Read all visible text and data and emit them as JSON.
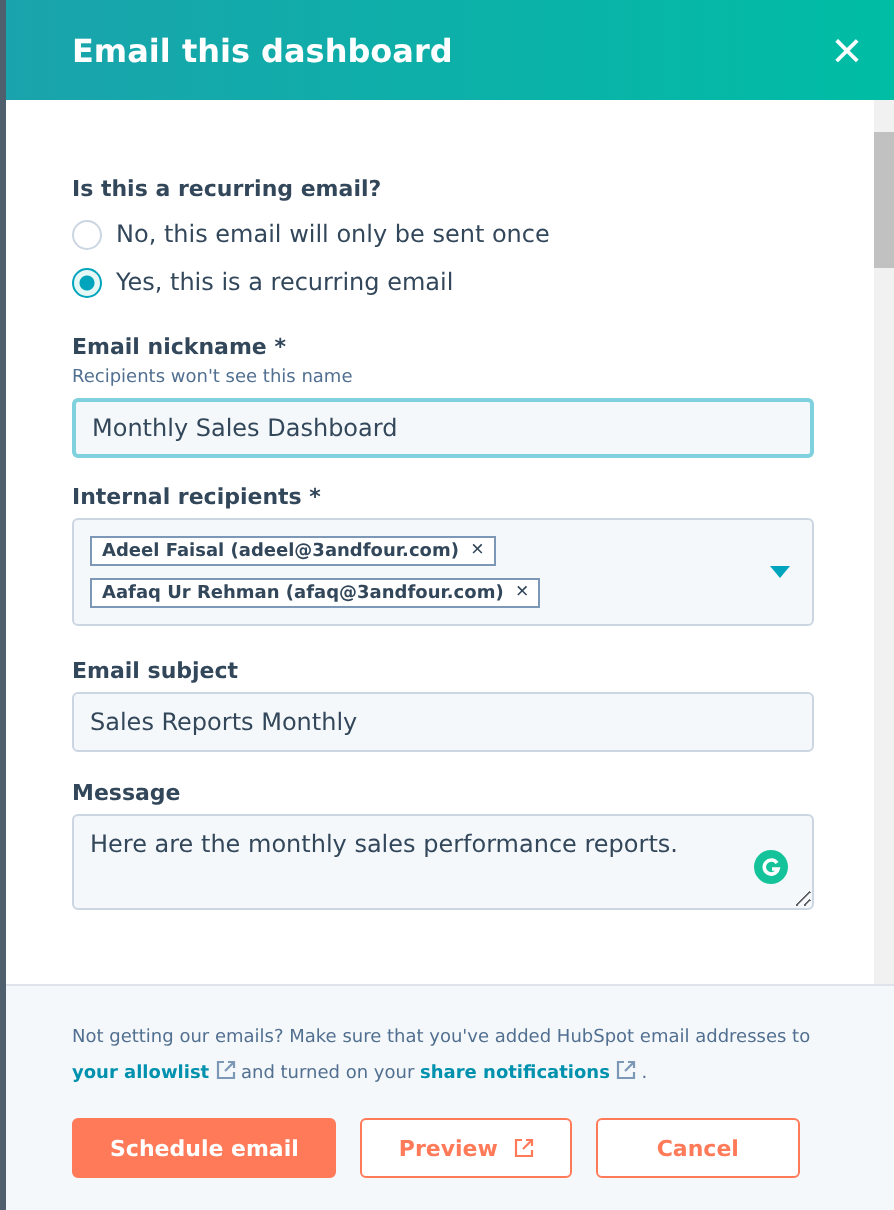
{
  "header": {
    "title": "Email this dashboard",
    "close": "×"
  },
  "recurring": {
    "label": "Is this a recurring email?",
    "options": [
      {
        "label": "No, this email will only be sent once",
        "selected": false
      },
      {
        "label": "Yes, this is a recurring email",
        "selected": true
      }
    ]
  },
  "nickname": {
    "label": "Email nickname *",
    "hint": "Recipients won't see this name",
    "value": "Monthly Sales Dashboard",
    "focused": true
  },
  "recipients": {
    "label": "Internal recipients *",
    "tags": [
      {
        "label": "Adeel Faisal (adeel@3andfour.com)",
        "remove": "×"
      },
      {
        "label": "Aafaq Ur Rehman (afaq@3andfour.com)",
        "remove": "×"
      }
    ]
  },
  "subject": {
    "label": "Email subject",
    "value": "Sales Reports Monthly"
  },
  "message": {
    "label": "Message",
    "value": "Here are the monthly sales performance reports."
  },
  "footer": {
    "note_before": "Not getting our emails? Make sure that you've added HubSpot email addresses to ",
    "link_1": "your allowlist",
    "note_middle": " and turned on your ",
    "link_2": "share notifications",
    "note_after": " .",
    "buttons": [
      {
        "label": "Schedule email",
        "kind": "primary",
        "external": false
      },
      {
        "label": "Preview",
        "kind": "secondary",
        "external": true
      },
      {
        "label": "Cancel",
        "kind": "secondary",
        "external": false
      }
    ]
  }
}
